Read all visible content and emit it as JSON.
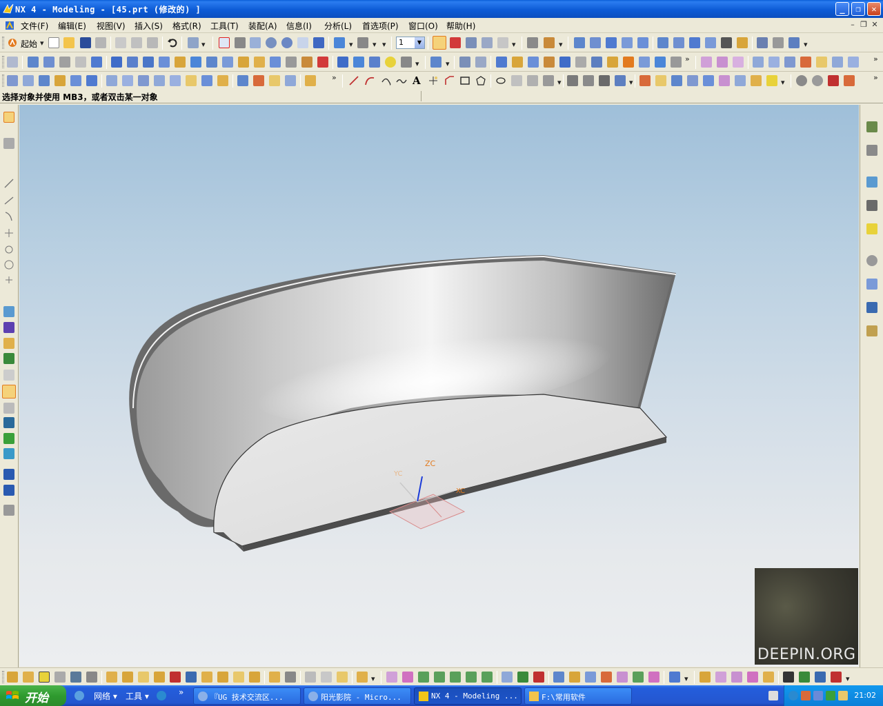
{
  "window": {
    "title": "NX 4 - Modeling - [45.prt  (修改的) ]",
    "min_glyph": "_",
    "max_glyph": "❐",
    "close_glyph": "✕"
  },
  "menubar": {
    "items": [
      "文件(F)",
      "编辑(E)",
      "视图(V)",
      "插入(S)",
      "格式(R)",
      "工具(T)",
      "装配(A)",
      "信息(I)",
      "分析(L)",
      "首选项(P)",
      "窗口(O)",
      "帮助(H)"
    ],
    "mdi_min": "–",
    "mdi_restore": "❐",
    "mdi_close": "✕"
  },
  "toolbar": {
    "start_label": "起始",
    "layer_value": "1",
    "combo_arrow": "▼",
    "overflow": "»"
  },
  "cue_line": {
    "text": "选择对象并使用 MB3，或者双击某一对象"
  },
  "viewport": {
    "csys_labels": {
      "zc": "ZC",
      "yc": "YC",
      "xc": "XC"
    }
  },
  "thumbnail": {
    "watermark": "DEEPIN.ORG"
  },
  "taskbar": {
    "start_label": "开始",
    "quick_items": [
      "网络 ▾",
      "工具 ▾"
    ],
    "overflow": "»",
    "tasks": [
      {
        "label": "『UG 技术交流区...",
        "active": false
      },
      {
        "label": "阳光影院 - Micro...",
        "active": false
      },
      {
        "label": "NX 4 - Modeling ...",
        "active": true
      },
      {
        "label": "F:\\常用软件",
        "active": false
      }
    ],
    "clock": "21:02"
  },
  "colors": {
    "titlebar": "#0d5bd6",
    "accent_orange": "#e27a1e",
    "shell_grey": "#8a8a8a"
  }
}
